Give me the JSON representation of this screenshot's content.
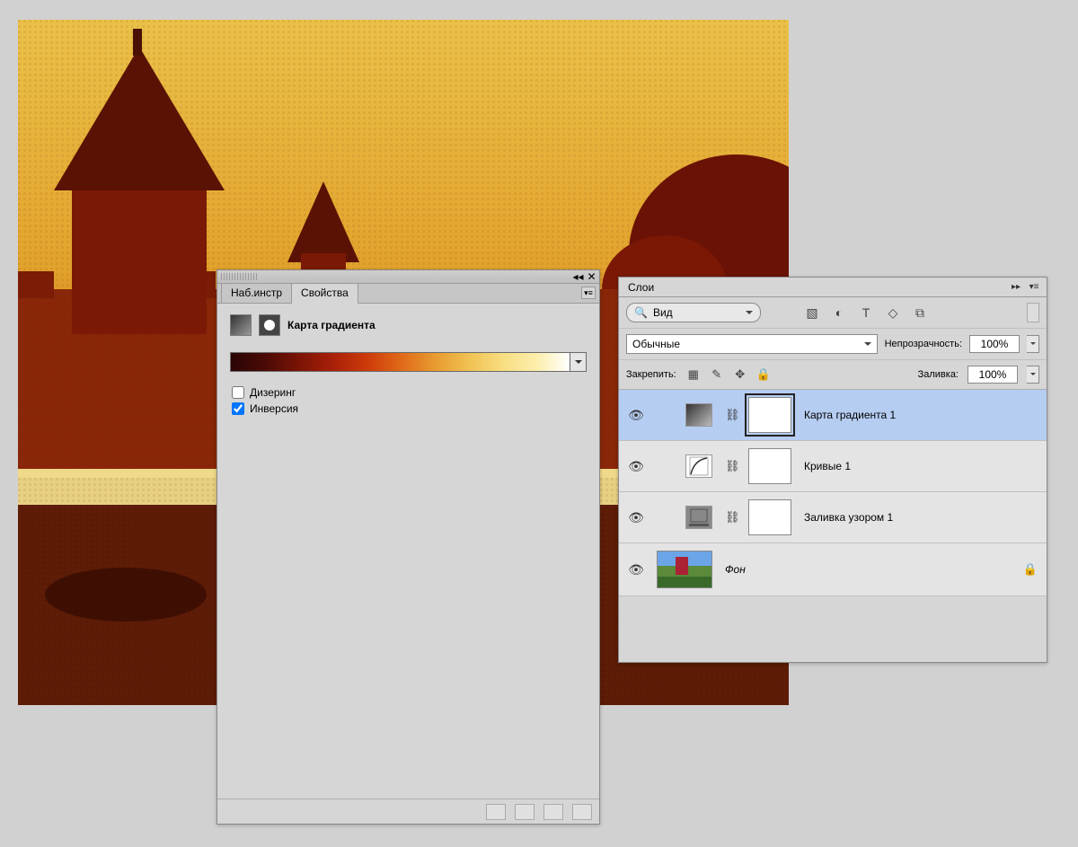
{
  "properties_panel": {
    "tabs": {
      "tools": "Наб.инстр",
      "properties": "Свойства"
    },
    "title": "Карта градиента",
    "dithering_label": "Дизеринг",
    "dithering_checked": false,
    "invert_label": "Инверсия",
    "invert_checked": true
  },
  "layers_panel": {
    "tab_label": "Слои",
    "kind_label": "Вид",
    "blend_mode": "Обычные",
    "opacity_label": "Непрозрачность:",
    "opacity_value": "100%",
    "lock_label": "Закрепить:",
    "fill_label": "Заливка:",
    "fill_value": "100%",
    "layers": [
      {
        "name": "Карта градиента 1",
        "selected": true,
        "type": "adjustment"
      },
      {
        "name": "Кривые 1",
        "selected": false,
        "type": "adjustment"
      },
      {
        "name": "Заливка узором 1",
        "selected": false,
        "type": "adjustment"
      },
      {
        "name": "Фон",
        "selected": false,
        "type": "background",
        "locked": true
      }
    ]
  },
  "colors": {
    "panel_bg": "#d6d6d6",
    "selection": "#b6cdf2"
  }
}
